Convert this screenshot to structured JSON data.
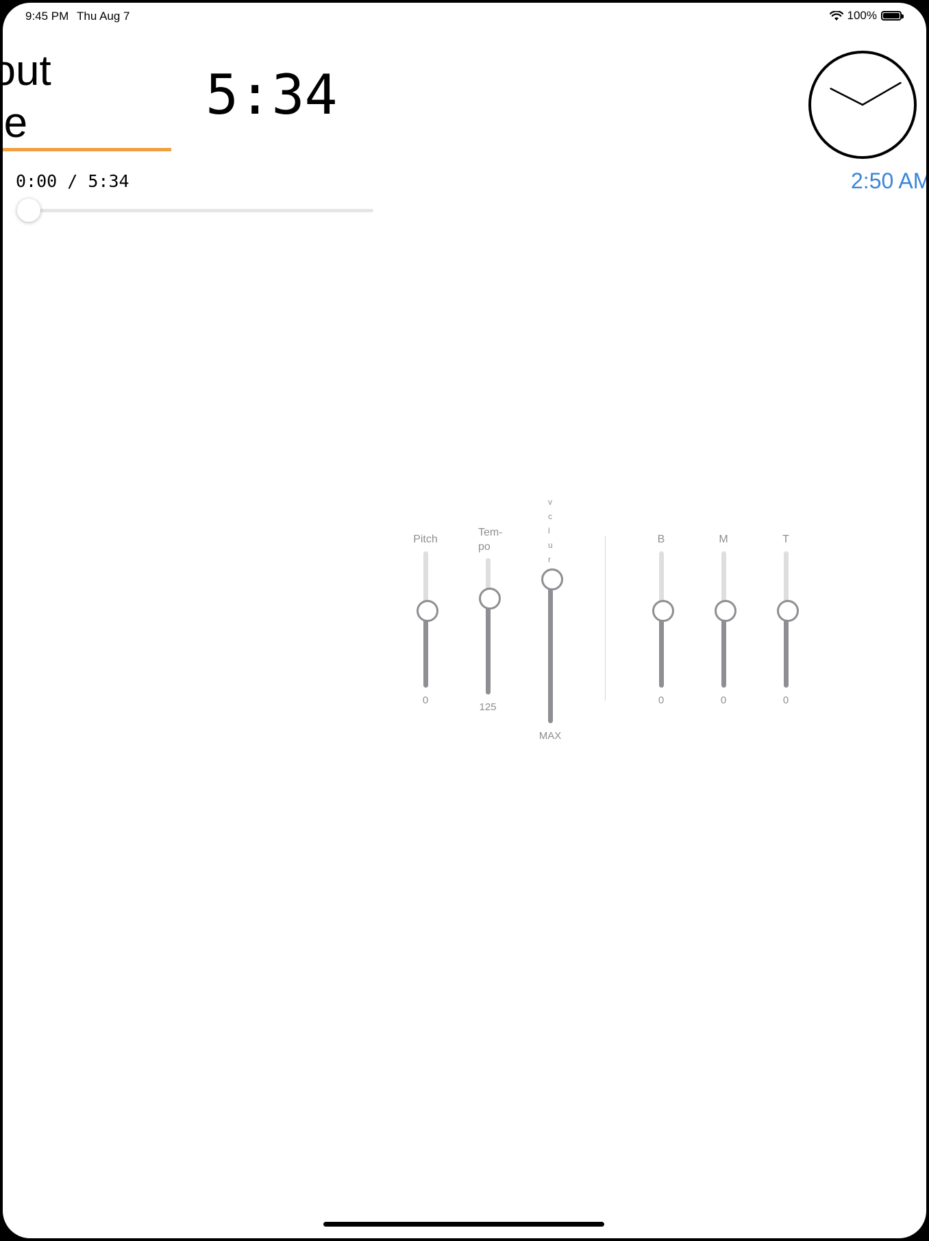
{
  "status_bar": {
    "time": "9:45 PM",
    "date": "Thu Aug 7",
    "battery_percent": "100%"
  },
  "track": {
    "title": "bout\nme",
    "total_time": "5:34",
    "elapsed_display": "0:00 / 5:34",
    "progress": 0
  },
  "clock": {
    "display_time": "2:50 AM",
    "hour_hand_angle_deg": 297,
    "minute_hand_angle_deg": 60
  },
  "eq": {
    "pitch": {
      "label": "Pitch",
      "value": "0"
    },
    "tempo": {
      "label": "Tem-\npo",
      "value": "125"
    },
    "volume": {
      "label_letters": [
        "v",
        "c",
        "l",
        "u",
        "r"
      ],
      "value": "MAX"
    },
    "bass": {
      "label": "B",
      "value": "0"
    },
    "mid": {
      "label": "M",
      "value": "0"
    },
    "treble": {
      "label": "T",
      "value": "0"
    }
  },
  "colors": {
    "accent": "#f0a040",
    "clock_text": "#3a85d8",
    "slider_fill": "#8e8e93",
    "slider_track": "#dedede"
  }
}
